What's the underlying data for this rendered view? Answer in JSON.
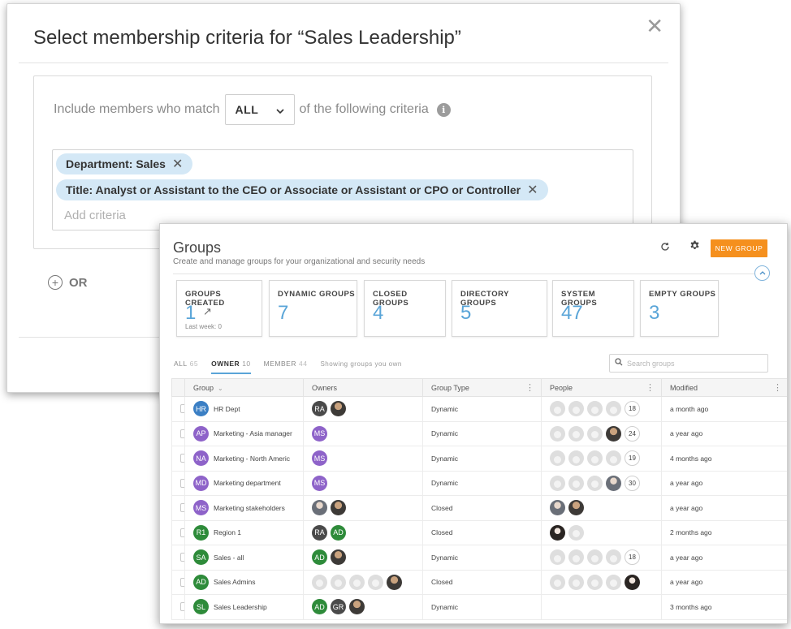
{
  "dialog": {
    "title": "Select membership criteria for “Sales Leadership”",
    "close": "✕",
    "match_prefix": "Include members who match",
    "match_value": "ALL",
    "match_suffix": "of the following criteria",
    "criteria": [
      "Department: Sales",
      "Title: Analyst or Assistant to the CEO or Associate or Assistant or CPO or Controller"
    ],
    "add_placeholder": "Add criteria",
    "or_label": "OR"
  },
  "groups": {
    "title": "Groups",
    "subtitle": "Create and manage groups for your organizational and security needs",
    "new_button": "NEW GROUP",
    "cards": [
      {
        "label": "GROUPS CREATED",
        "value": "1",
        "foot": "Last week: 0"
      },
      {
        "label": "DYNAMIC GROUPS",
        "value": "7"
      },
      {
        "label": "CLOSED GROUPS",
        "value": "4"
      },
      {
        "label": "DIRECTORY GROUPS",
        "value": "5"
      },
      {
        "label": "SYSTEM GROUPS",
        "value": "47"
      },
      {
        "label": "EMPTY GROUPS",
        "value": "3"
      }
    ],
    "tabs": [
      {
        "label": "ALL",
        "count": "65"
      },
      {
        "label": "OWNER",
        "count": "10"
      },
      {
        "label": "MEMBER",
        "count": "44"
      }
    ],
    "tab_note": "Showing groups you own",
    "search_placeholder": "Search groups",
    "columns": {
      "group": "Group",
      "owners": "Owners",
      "type": "Group Type",
      "people": "People",
      "modified": "Modified"
    },
    "rows": [
      {
        "initials": "HR",
        "color": "#3b7fc4",
        "name": "HR Dept",
        "type": "Dynamic",
        "modified": "a month ago"
      },
      {
        "initials": "AP",
        "color": "#8e63c9",
        "name": "Marketing - Asia manager",
        "type": "Dynamic",
        "modified": "a year ago"
      },
      {
        "initials": "NA",
        "color": "#8e63c9",
        "name": "Marketing - North Americ",
        "type": "Dynamic",
        "modified": "4 months ago"
      },
      {
        "initials": "MD",
        "color": "#8e63c9",
        "name": "Marketing department",
        "type": "Dynamic",
        "modified": "a year ago"
      },
      {
        "initials": "MS",
        "color": "#8e63c9",
        "name": "Marketing stakeholders",
        "type": "Closed",
        "modified": "a year ago"
      },
      {
        "initials": "R1",
        "color": "#2e8b3a",
        "name": "Region 1",
        "type": "Closed",
        "modified": "2 months ago"
      },
      {
        "initials": "SA",
        "color": "#2e8b3a",
        "name": "Sales - all",
        "type": "Dynamic",
        "modified": "a year ago"
      },
      {
        "initials": "AD",
        "color": "#2e8b3a",
        "name": "Sales Admins",
        "type": "Closed",
        "modified": "a year ago"
      },
      {
        "initials": "SL",
        "color": "#2e8b3a",
        "name": "Sales Leadership",
        "type": "Dynamic",
        "modified": "3 months ago"
      }
    ],
    "owner_initials": {
      "RA": "RA",
      "MS": "MS",
      "AD": "AD",
      "GR": "GR"
    },
    "people_counts": [
      "18",
      "24",
      "19",
      "30",
      "18"
    ]
  }
}
